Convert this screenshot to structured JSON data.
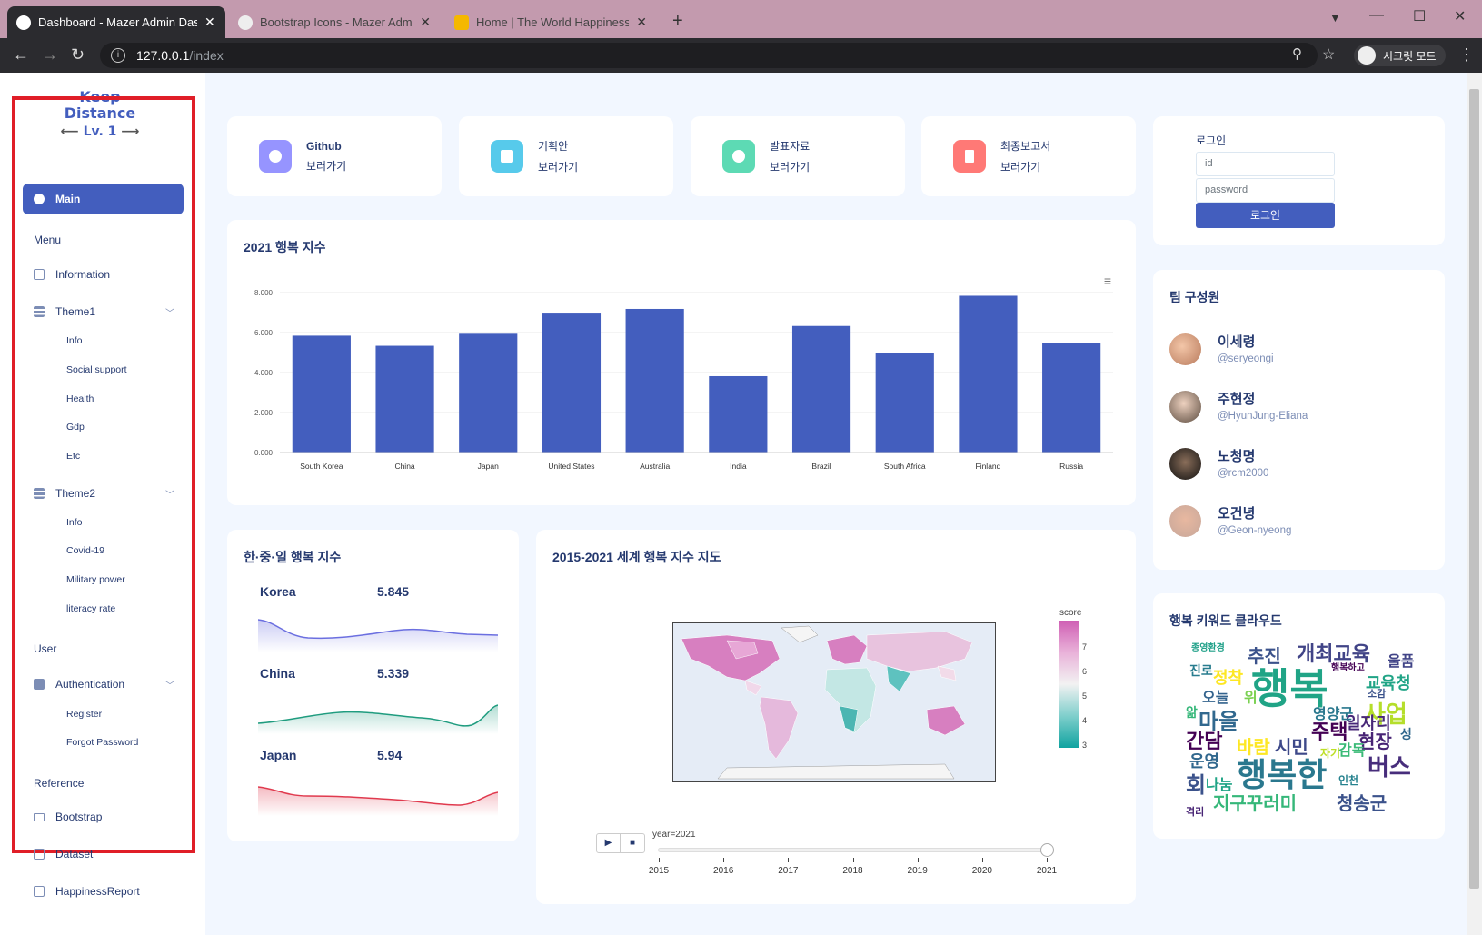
{
  "browser": {
    "tabs": [
      {
        "title": "Dashboard - Mazer Admin Dash",
        "active": true
      },
      {
        "title": "Bootstrap Icons - Mazer Admin",
        "active": false
      },
      {
        "title": "Home | The World Happiness Re",
        "active": false
      }
    ],
    "url_host": "127.0.0.1",
    "url_path": "/index",
    "profile_label": "시크릿 모드"
  },
  "sidebar": {
    "logo_line1": "Keep",
    "logo_line2": "Distance",
    "logo_line3": "Lv. 1",
    "main_label": "Main",
    "menu_title": "Menu",
    "information_label": "Information",
    "theme1_label": "Theme1",
    "theme1_items": [
      "Info",
      "Social support",
      "Health",
      "Gdp",
      "Etc"
    ],
    "theme2_label": "Theme2",
    "theme2_items": [
      "Info",
      "Covid-19",
      "Military power",
      "literacy rate"
    ],
    "user_title": "User",
    "auth_label": "Authentication",
    "auth_items": [
      "Register",
      "Forgot Password"
    ],
    "reference_title": "Reference",
    "reference_items": [
      "Bootstrap",
      "Dataset",
      "HappinessReport"
    ]
  },
  "stat_cards": [
    {
      "title": "Github",
      "subtitle": "보러가기",
      "color": "#9694ff",
      "icon": "eye-icon"
    },
    {
      "title": "기획안",
      "subtitle": "보러가기",
      "color": "#57caeb",
      "icon": "list-icon"
    },
    {
      "title": "발표자료",
      "subtitle": "보러가기",
      "color": "#5ddab4",
      "icon": "person-icon"
    },
    {
      "title": "최종보고서",
      "subtitle": "보러가기",
      "color": "#ff7976",
      "icon": "bookmark-icon"
    }
  ],
  "login": {
    "title": "로그인",
    "id_placeholder": "id",
    "password_placeholder": "password",
    "button_label": "로그인"
  },
  "bar_card_title": "2021 행복 지수",
  "chart_data": {
    "type": "bar",
    "categories": [
      "South Korea",
      "China",
      "Japan",
      "United States",
      "Australia",
      "India",
      "Brazil",
      "South Africa",
      "Finland",
      "Russia"
    ],
    "values": [
      5.845,
      5.339,
      5.94,
      6.951,
      7.183,
      3.819,
      6.33,
      4.956,
      7.842,
      5.477
    ],
    "ylim": [
      0,
      8
    ],
    "yticks": [
      "0.000",
      "2.000",
      "4.000",
      "6.000",
      "8.000"
    ],
    "color": "#435ebe"
  },
  "chj_card": {
    "title": "한·중·일 행복 지수",
    "rows": [
      {
        "country": "Korea",
        "value": "5.845",
        "color": "#6b6fe0"
      },
      {
        "country": "China",
        "value": "5.339",
        "color": "#1f9c7f"
      },
      {
        "country": "Japan",
        "value": "5.94",
        "color": "#e03a4e"
      }
    ]
  },
  "map_card": {
    "title": "2015-2021 세계 행복 지수 지도",
    "colorbar_title": "score",
    "colorbar_ticks": [
      "7",
      "6",
      "5",
      "4",
      "3"
    ],
    "slider_label": "year=2021",
    "years": [
      "2015",
      "2016",
      "2017",
      "2018",
      "2019",
      "2020",
      "2021"
    ],
    "play_icon": "play-icon",
    "stop_icon": "stop-icon"
  },
  "team": {
    "title": "팀 구성원",
    "members": [
      {
        "name": "이세령",
        "handle": "@seryeongi"
      },
      {
        "name": "주현정",
        "handle": "@HyunJung-Eliana"
      },
      {
        "name": "노청명",
        "handle": "@rcm2000"
      },
      {
        "name": "오건녕",
        "handle": "@Geon-nyeong"
      }
    ]
  },
  "wordcloud": {
    "title": "행복 키워드 클라우드",
    "words": [
      "행복",
      "행복한",
      "개최교육",
      "추진",
      "사업",
      "마을",
      "주택",
      "시민",
      "버스",
      "지구꾸러미",
      "청송군",
      "현장",
      "간담",
      "바람",
      "운영",
      "교육청",
      "일자리",
      "영양군",
      "감독",
      "오늘",
      "위",
      "자기",
      "회",
      "나눔",
      "정착",
      "행복하고",
      "울품",
      "소감",
      "종영환경",
      "인천",
      "성",
      "앎",
      "진로",
      "격리"
    ]
  }
}
